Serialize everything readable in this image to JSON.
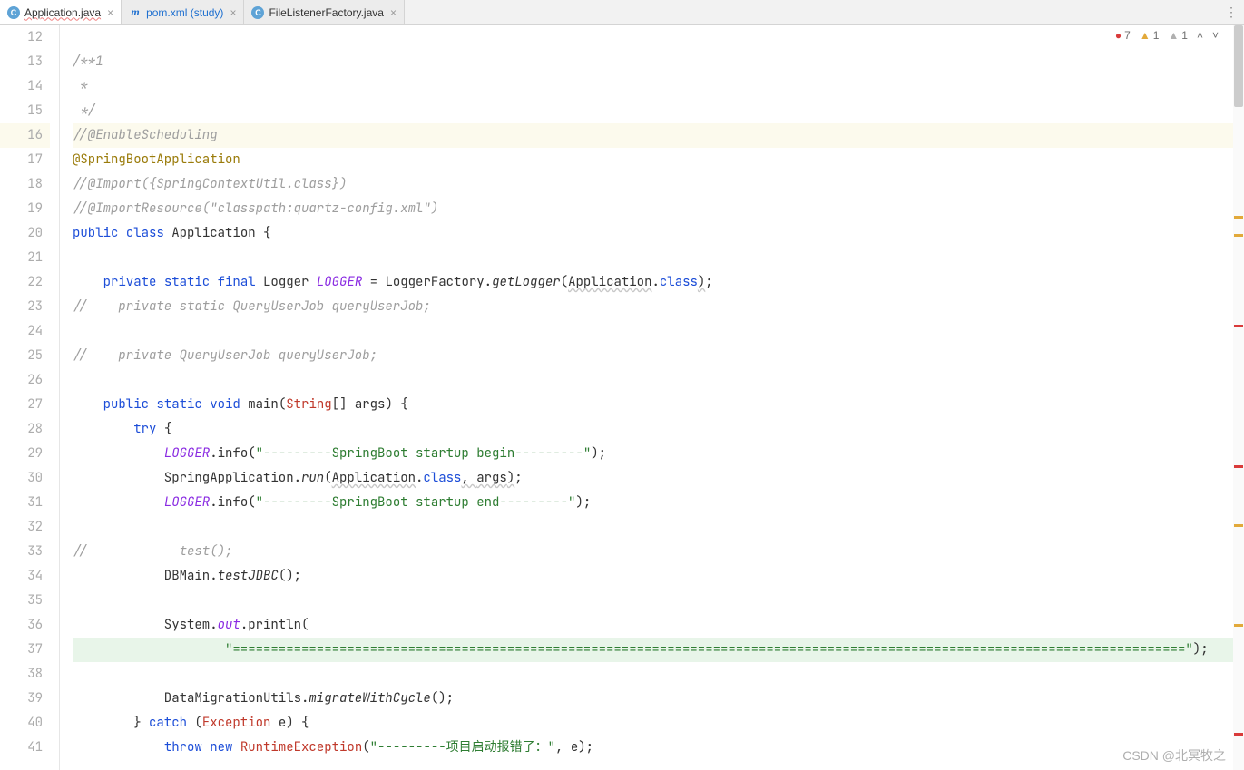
{
  "tabs": [
    {
      "icon": "C",
      "label": "Application.java",
      "active": true,
      "blue": false,
      "underline": true
    },
    {
      "icon": "m",
      "label": "pom.xml (study)",
      "active": false,
      "blue": true,
      "underline": false
    },
    {
      "icon": "C",
      "label": "FileListenerFactory.java",
      "active": false,
      "blue": false,
      "underline": false
    }
  ],
  "inspections": {
    "errors": "7",
    "warnings": "1",
    "weak": "1"
  },
  "lines": [
    {
      "n": "12",
      "segs": []
    },
    {
      "n": "13",
      "segs": [
        {
          "t": "/**1",
          "c": "c-comment"
        }
      ]
    },
    {
      "n": "14",
      "segs": [
        {
          "t": " *",
          "c": "c-comment"
        }
      ]
    },
    {
      "n": "15",
      "segs": [
        {
          "t": " */",
          "c": "c-comment"
        }
      ]
    },
    {
      "n": "16",
      "current": true,
      "segs": [
        {
          "t": "//@EnableScheduling",
          "c": "c-comment"
        }
      ]
    },
    {
      "n": "17",
      "segs": [
        {
          "t": "@SpringBootApplication",
          "c": "c-anno"
        }
      ]
    },
    {
      "n": "18",
      "segs": [
        {
          "t": "//@Import({SpringContextUtil.class})",
          "c": "c-comment"
        }
      ]
    },
    {
      "n": "19",
      "segs": [
        {
          "t": "//@ImportResource(\"classpath:quartz-config.xml\")",
          "c": "c-comment"
        }
      ]
    },
    {
      "n": "20",
      "segs": [
        {
          "t": "public ",
          "c": "c-kw"
        },
        {
          "t": "class ",
          "c": "c-kw"
        },
        {
          "t": "Application "
        },
        {
          "t": "{"
        }
      ]
    },
    {
      "n": "21",
      "segs": []
    },
    {
      "n": "22",
      "segs": [
        {
          "t": "    "
        },
        {
          "t": "private ",
          "c": "c-kw"
        },
        {
          "t": "static ",
          "c": "c-kw"
        },
        {
          "t": "final ",
          "c": "c-kw"
        },
        {
          "t": "Logger "
        },
        {
          "t": "LOGGER",
          "c": "c-field"
        },
        {
          "t": " = LoggerFactory."
        },
        {
          "t": "getLogger",
          "c": "c-method-i"
        },
        {
          "t": "("
        },
        {
          "t": "Application",
          "c": "wavy"
        },
        {
          "t": "."
        },
        {
          "t": "class",
          "c": "c-kw"
        },
        {
          "t": ")",
          "c": "wavy"
        },
        {
          "t": ";"
        }
      ]
    },
    {
      "n": "23",
      "segs": [
        {
          "t": "//    private static QueryUserJob queryUserJob;",
          "c": "c-comment"
        }
      ]
    },
    {
      "n": "24",
      "segs": []
    },
    {
      "n": "25",
      "segs": [
        {
          "t": "//    private QueryUserJob queryUserJob;",
          "c": "c-comment"
        }
      ]
    },
    {
      "n": "26",
      "segs": []
    },
    {
      "n": "27",
      "segs": [
        {
          "t": "    "
        },
        {
          "t": "public ",
          "c": "c-kw"
        },
        {
          "t": "static ",
          "c": "c-kw"
        },
        {
          "t": "void ",
          "c": "c-kw"
        },
        {
          "t": "main"
        },
        {
          "t": "("
        },
        {
          "t": "String",
          "c": "c-class"
        },
        {
          "t": "[] args) {"
        }
      ]
    },
    {
      "n": "28",
      "segs": [
        {
          "t": "        "
        },
        {
          "t": "try ",
          "c": "c-kw"
        },
        {
          "t": "{"
        }
      ]
    },
    {
      "n": "29",
      "segs": [
        {
          "t": "            "
        },
        {
          "t": "LOGGER",
          "c": "c-field"
        },
        {
          "t": ".info("
        },
        {
          "t": "\"---------SpringBoot startup begin---------\"",
          "c": "c-str"
        },
        {
          "t": ");"
        }
      ]
    },
    {
      "n": "30",
      "segs": [
        {
          "t": "            SpringApplication."
        },
        {
          "t": "run",
          "c": "c-method-i"
        },
        {
          "t": "("
        },
        {
          "t": "Application",
          "c": "wavy"
        },
        {
          "t": "."
        },
        {
          "t": "class",
          "c": "c-kw"
        },
        {
          "t": ", ",
          "c": "wavy"
        },
        {
          "t": "args",
          "c": "wavy"
        },
        {
          "t": ")",
          "c": "wavy"
        },
        {
          "t": ";"
        }
      ]
    },
    {
      "n": "31",
      "segs": [
        {
          "t": "            "
        },
        {
          "t": "LOGGER",
          "c": "c-field"
        },
        {
          "t": ".info("
        },
        {
          "t": "\"---------SpringBoot startup end---------\"",
          "c": "c-str"
        },
        {
          "t": ");"
        }
      ]
    },
    {
      "n": "32",
      "segs": []
    },
    {
      "n": "33",
      "segs": [
        {
          "t": "//            test();",
          "c": "c-comment"
        }
      ]
    },
    {
      "n": "34",
      "segs": [
        {
          "t": "            DBMain."
        },
        {
          "t": "testJDBC",
          "c": "c-method-i"
        },
        {
          "t": "();"
        }
      ]
    },
    {
      "n": "35",
      "segs": []
    },
    {
      "n": "36",
      "segs": [
        {
          "t": "            System."
        },
        {
          "t": "out",
          "c": "c-field"
        },
        {
          "t": ".println("
        }
      ]
    },
    {
      "n": "37",
      "green": true,
      "segs": [
        {
          "t": "                    "
        },
        {
          "t": "\"=============================================================================================================================\"",
          "c": "c-str"
        },
        {
          "t": ");"
        }
      ]
    },
    {
      "n": "38",
      "segs": []
    },
    {
      "n": "39",
      "segs": [
        {
          "t": "            DataMigrationUtils."
        },
        {
          "t": "migrateWithCycle",
          "c": "c-method-i"
        },
        {
          "t": "();"
        }
      ]
    },
    {
      "n": "40",
      "segs": [
        {
          "t": "        } "
        },
        {
          "t": "catch ",
          "c": "c-kw"
        },
        {
          "t": "("
        },
        {
          "t": "Exception",
          "c": "c-class"
        },
        {
          "t": " e) {"
        }
      ]
    },
    {
      "n": "41",
      "segs": [
        {
          "t": "            "
        },
        {
          "t": "throw ",
          "c": "c-kw"
        },
        {
          "t": "new ",
          "c": "c-kw"
        },
        {
          "t": "RuntimeException",
          "c": "c-class"
        },
        {
          "t": "("
        },
        {
          "t": "\"---------项目启动报错了：\"",
          "c": "c-str"
        },
        {
          "t": ", e);"
        }
      ]
    }
  ],
  "scroll_marks": [
    {
      "pos": 210,
      "c": "y"
    },
    {
      "pos": 230,
      "c": "y"
    },
    {
      "pos": 330,
      "c": "r"
    },
    {
      "pos": 485,
      "c": "r"
    },
    {
      "pos": 550,
      "c": "y"
    },
    {
      "pos": 660,
      "c": "y"
    },
    {
      "pos": 780,
      "c": "r"
    }
  ],
  "watermark": "CSDN @北冥牧之"
}
